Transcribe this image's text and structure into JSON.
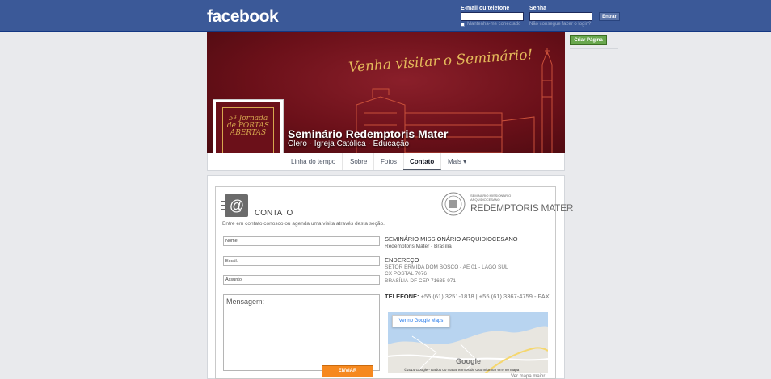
{
  "header": {
    "logo": "facebook",
    "email_label": "E-mail ou telefone",
    "password_label": "Senha",
    "login_button": "Entrar",
    "keep_logged": "Mantenha-me conectado",
    "forgot": "Não consegue fazer o login?"
  },
  "sidebar": {
    "create_page": "Criar Página"
  },
  "cover": {
    "slogan": "Venha visitar o Seminário!",
    "page_name": "Seminário Redemptoris Mater",
    "categories": "Clero · Igreja Católica · Educação",
    "profile_text": "5ª Jornada de PORTAS ABERTAS"
  },
  "tabs": [
    {
      "label": "Linha do tempo"
    },
    {
      "label": "Sobre"
    },
    {
      "label": "Fotos"
    },
    {
      "label": "Contato"
    },
    {
      "label": "Mais ▾"
    }
  ],
  "contact": {
    "title": "CONTATO",
    "intro": "Entre em contato conosco ou agenda uma visita através desta seção.",
    "logo_small_1": "SEMINÁRIO MISSIONÁRIO",
    "logo_small_2": "ARQUIDIOCESANO",
    "logo_big": "REDEMPTORIS MATER",
    "fields": {
      "name": "Nome:",
      "email": "Email:",
      "subject": "Assunto:",
      "message": "Mensagem:"
    },
    "send_button": "ENVIAR",
    "org_name": "SEMINÁRIO MISSIONÁRIO ARQUIDIOCESANO",
    "org_sub": "Redemptoris Mater - Brasília",
    "address_label": "ENDEREÇO",
    "address_1": "SETOR ERMIDA DOM BOSCO - AE 01 - LAGO SUL",
    "address_2": "CX POSTAL 7076",
    "address_3": "BRASÍLIA-DF CEP 71635-971",
    "phone_label": "TELEFONE:",
    "phone": " +55 (61) 3251-1818 | +55 (61) 3367-4759 - FAX",
    "map_button": "Ver no Google Maps",
    "map_footer": "©2014 Google - Dados do mapa      Termos de Uso      Informar erro no mapa",
    "google": "Google",
    "map_bigger": "Ver mapa maior"
  }
}
